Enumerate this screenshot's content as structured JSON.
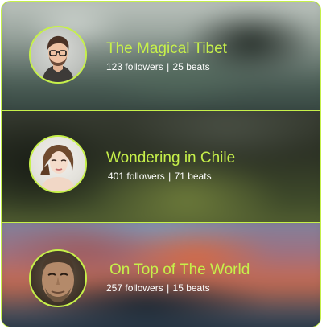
{
  "channels": [
    {
      "title": "The Magical Tibet",
      "followers": "123 followers",
      "separator": "|",
      "beats": "25 beats"
    },
    {
      "title": "Wondering in Chile",
      "followers": "401 followers",
      "separator": "|",
      "beats": "71 beats"
    },
    {
      "title": "On Top of The World",
      "followers": "257 followers",
      "separator": "|",
      "beats": "15 beats"
    }
  ],
  "colors": {
    "accent": "#c6f04a",
    "meta_text": "#ffffff"
  }
}
